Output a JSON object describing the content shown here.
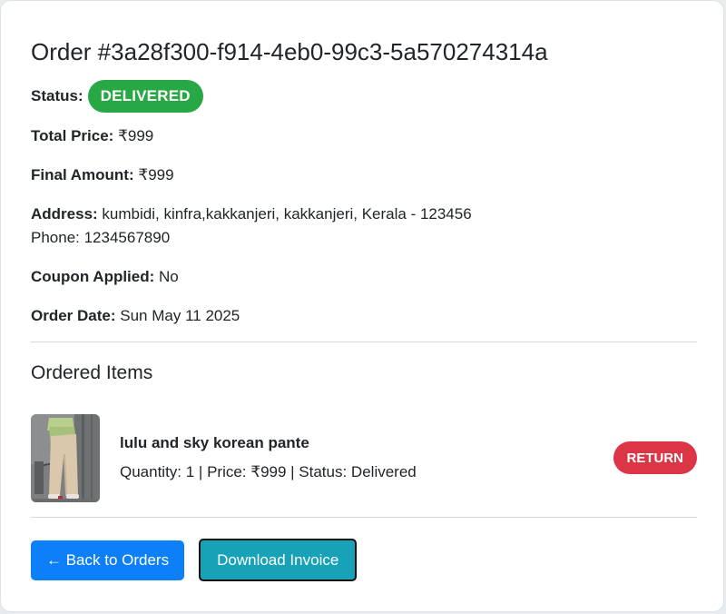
{
  "order": {
    "title": "Order #3a28f300-f914-4eb0-99c3-5a570274314a",
    "status_label": "Status:",
    "status_value": "DELIVERED",
    "status_color": "#28a745",
    "total_price_label": "Total Price:",
    "total_price_value": "₹999",
    "final_amount_label": "Final Amount:",
    "final_amount_value": "₹999",
    "address_label": "Address:",
    "address_value": "kumbidi, kinfra,kakkanjeri, kakkanjeri, Kerala - 123456",
    "phone_text": "Phone: 1234567890",
    "coupon_label": "Coupon Applied:",
    "coupon_value": "No",
    "order_date_label": "Order Date:",
    "order_date_value": "Sun May 11 2025"
  },
  "items_section": {
    "heading": "Ordered Items",
    "items": [
      {
        "name": "lulu and sky korean pante",
        "meta": "Quantity: 1 | Price: ₹999 | Status: Delivered",
        "return_label": "RETURN",
        "image_icon": "product-photo-trousers"
      }
    ]
  },
  "actions": {
    "back_label": "← Back to Orders",
    "invoice_label": "Download Invoice"
  },
  "colors": {
    "primary": "#0d7ff9",
    "info": "#17a2b8",
    "danger": "#dc3545",
    "success": "#28a745"
  }
}
